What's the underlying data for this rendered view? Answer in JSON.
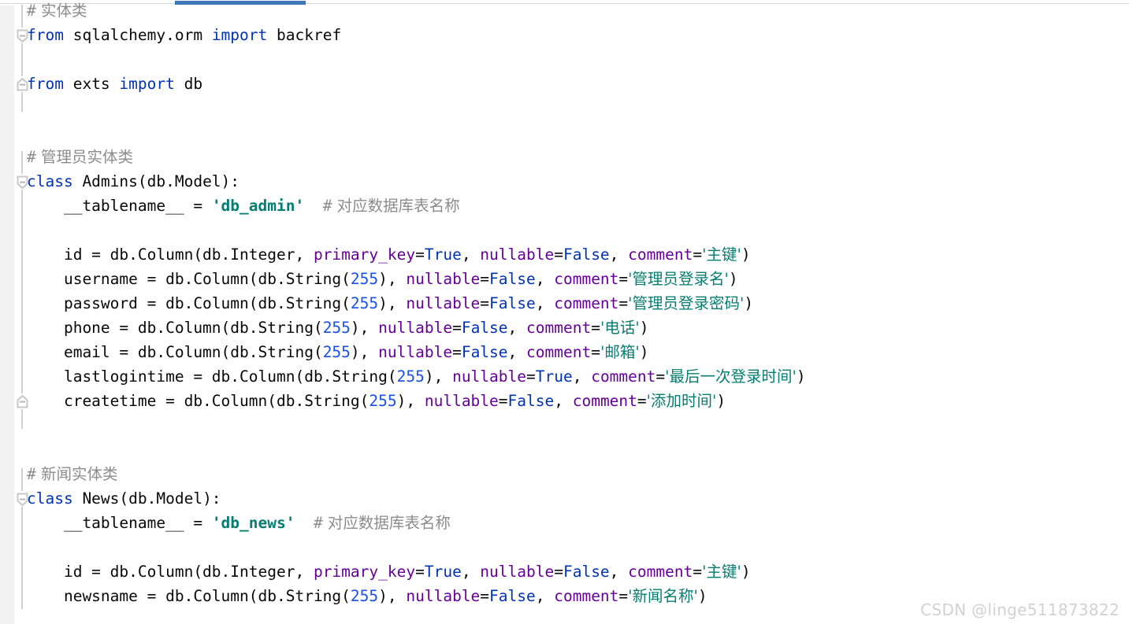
{
  "window": {
    "app": "code-editor",
    "accent_color": "#3c78b8",
    "background_color": "#ffffff",
    "gutter_color": "#f2f2f2"
  },
  "tab_strip": {
    "active_tab_underline_color": "#3c78b8"
  },
  "gutter": {
    "fold_markers": [
      {
        "type": "fold-collapse-start",
        "line": 2
      },
      {
        "type": "fold-collapse-end",
        "line": 4
      },
      {
        "type": "fold-collapse-start",
        "line": 8
      },
      {
        "type": "fold-collapse-end",
        "line": 17
      },
      {
        "type": "fold-collapse-start",
        "line": 21
      }
    ]
  },
  "editor": {
    "language": "python",
    "syntax_colors": {
      "keyword": "#0033b3",
      "comment": "#8c8c8c",
      "string": "#067d72",
      "number": "#1750eb",
      "keyword_argument": "#660099",
      "constant": "#0033b3",
      "default_text": "#080808"
    },
    "lines": [
      {
        "n": 1,
        "tokens": [
          {
            "t": "comment",
            "v": "#"
          },
          {
            "t": "comment-cjk",
            "v": " 实体类"
          }
        ]
      },
      {
        "n": 2,
        "tokens": [
          {
            "t": "kw",
            "v": "from"
          },
          {
            "t": "plain",
            "v": " sqlalchemy.orm "
          },
          {
            "t": "kw",
            "v": "import"
          },
          {
            "t": "plain",
            "v": " backref"
          }
        ]
      },
      {
        "n": 3,
        "tokens": []
      },
      {
        "n": 4,
        "tokens": [
          {
            "t": "kw",
            "v": "from"
          },
          {
            "t": "plain",
            "v": " exts "
          },
          {
            "t": "kw",
            "v": "import"
          },
          {
            "t": "plain",
            "v": " db"
          }
        ]
      },
      {
        "n": 5,
        "tokens": []
      },
      {
        "n": 6,
        "tokens": []
      },
      {
        "n": 7,
        "tokens": [
          {
            "t": "comment",
            "v": "#"
          },
          {
            "t": "comment-cjk",
            "v": " 管理员实体类"
          }
        ]
      },
      {
        "n": 8,
        "tokens": [
          {
            "t": "kw",
            "v": "class"
          },
          {
            "t": "plain",
            "v": " Admins(db.Model):"
          }
        ]
      },
      {
        "n": 9,
        "tokens": [
          {
            "t": "plain",
            "v": "    __tablename__ = "
          },
          {
            "t": "str-b",
            "v": "'db_admin'"
          },
          {
            "t": "plain",
            "v": "  "
          },
          {
            "t": "comment",
            "v": "#"
          },
          {
            "t": "comment-cjk",
            "v": " 对应数据库表名称"
          }
        ]
      },
      {
        "n": 10,
        "tokens": []
      },
      {
        "n": 11,
        "tokens": [
          {
            "t": "plain",
            "v": "    id = db.Column(db.Integer, "
          },
          {
            "t": "kwarg",
            "v": "primary_key"
          },
          {
            "t": "plain",
            "v": "="
          },
          {
            "t": "const",
            "v": "True"
          },
          {
            "t": "plain",
            "v": ", "
          },
          {
            "t": "kwarg",
            "v": "nullable"
          },
          {
            "t": "plain",
            "v": "="
          },
          {
            "t": "const",
            "v": "False"
          },
          {
            "t": "plain",
            "v": ", "
          },
          {
            "t": "kwarg",
            "v": "comment"
          },
          {
            "t": "plain",
            "v": "="
          },
          {
            "t": "str-cjk",
            "v": "'主键'"
          },
          {
            "t": "plain",
            "v": ")"
          }
        ]
      },
      {
        "n": 12,
        "tokens": [
          {
            "t": "plain",
            "v": "    username = db.Column(db.String("
          },
          {
            "t": "num",
            "v": "255"
          },
          {
            "t": "plain",
            "v": "), "
          },
          {
            "t": "kwarg",
            "v": "nullable"
          },
          {
            "t": "plain",
            "v": "="
          },
          {
            "t": "const",
            "v": "False"
          },
          {
            "t": "plain",
            "v": ", "
          },
          {
            "t": "kwarg",
            "v": "comment"
          },
          {
            "t": "plain",
            "v": "="
          },
          {
            "t": "str-cjk",
            "v": "'管理员登录名'"
          },
          {
            "t": "plain",
            "v": ")"
          }
        ]
      },
      {
        "n": 13,
        "tokens": [
          {
            "t": "plain",
            "v": "    password = db.Column(db.String("
          },
          {
            "t": "num",
            "v": "255"
          },
          {
            "t": "plain",
            "v": "), "
          },
          {
            "t": "kwarg",
            "v": "nullable"
          },
          {
            "t": "plain",
            "v": "="
          },
          {
            "t": "const",
            "v": "False"
          },
          {
            "t": "plain",
            "v": ", "
          },
          {
            "t": "kwarg",
            "v": "comment"
          },
          {
            "t": "plain",
            "v": "="
          },
          {
            "t": "str-cjk",
            "v": "'管理员登录密码'"
          },
          {
            "t": "plain",
            "v": ")"
          }
        ]
      },
      {
        "n": 14,
        "tokens": [
          {
            "t": "plain",
            "v": "    phone = db.Column(db.String("
          },
          {
            "t": "num",
            "v": "255"
          },
          {
            "t": "plain",
            "v": "), "
          },
          {
            "t": "kwarg",
            "v": "nullable"
          },
          {
            "t": "plain",
            "v": "="
          },
          {
            "t": "const",
            "v": "False"
          },
          {
            "t": "plain",
            "v": ", "
          },
          {
            "t": "kwarg",
            "v": "comment"
          },
          {
            "t": "plain",
            "v": "="
          },
          {
            "t": "str-cjk",
            "v": "'电话'"
          },
          {
            "t": "plain",
            "v": ")"
          }
        ]
      },
      {
        "n": 15,
        "tokens": [
          {
            "t": "plain",
            "v": "    email = db.Column(db.String("
          },
          {
            "t": "num",
            "v": "255"
          },
          {
            "t": "plain",
            "v": "), "
          },
          {
            "t": "kwarg",
            "v": "nullable"
          },
          {
            "t": "plain",
            "v": "="
          },
          {
            "t": "const",
            "v": "False"
          },
          {
            "t": "plain",
            "v": ", "
          },
          {
            "t": "kwarg",
            "v": "comment"
          },
          {
            "t": "plain",
            "v": "="
          },
          {
            "t": "str-cjk",
            "v": "'邮箱'"
          },
          {
            "t": "plain",
            "v": ")"
          }
        ]
      },
      {
        "n": 16,
        "tokens": [
          {
            "t": "plain",
            "v": "    lastlogintime = db.Column(db.String("
          },
          {
            "t": "num",
            "v": "255"
          },
          {
            "t": "plain",
            "v": "), "
          },
          {
            "t": "kwarg",
            "v": "nullable"
          },
          {
            "t": "plain",
            "v": "="
          },
          {
            "t": "const",
            "v": "True"
          },
          {
            "t": "plain",
            "v": ", "
          },
          {
            "t": "kwarg",
            "v": "comment"
          },
          {
            "t": "plain",
            "v": "="
          },
          {
            "t": "str-cjk",
            "v": "'最后一次登录时间'"
          },
          {
            "t": "plain",
            "v": ")"
          }
        ]
      },
      {
        "n": 17,
        "tokens": [
          {
            "t": "plain",
            "v": "    createtime = db.Column(db.String("
          },
          {
            "t": "num",
            "v": "255"
          },
          {
            "t": "plain",
            "v": "), "
          },
          {
            "t": "kwarg",
            "v": "nullable"
          },
          {
            "t": "plain",
            "v": "="
          },
          {
            "t": "const",
            "v": "False"
          },
          {
            "t": "plain",
            "v": ", "
          },
          {
            "t": "kwarg",
            "v": "comment"
          },
          {
            "t": "plain",
            "v": "="
          },
          {
            "t": "str-cjk",
            "v": "'添加时间'"
          },
          {
            "t": "plain",
            "v": ")"
          }
        ]
      },
      {
        "n": 18,
        "tokens": []
      },
      {
        "n": 19,
        "tokens": []
      },
      {
        "n": 20,
        "tokens": [
          {
            "t": "comment",
            "v": "#"
          },
          {
            "t": "comment-cjk",
            "v": " 新闻实体类"
          }
        ]
      },
      {
        "n": 21,
        "tokens": [
          {
            "t": "kw",
            "v": "class"
          },
          {
            "t": "plain",
            "v": " News(db.Model):"
          }
        ]
      },
      {
        "n": 22,
        "tokens": [
          {
            "t": "plain",
            "v": "    __tablename__ = "
          },
          {
            "t": "str-b",
            "v": "'db_news'"
          },
          {
            "t": "plain",
            "v": "  "
          },
          {
            "t": "comment",
            "v": "#"
          },
          {
            "t": "comment-cjk",
            "v": " 对应数据库表名称"
          }
        ]
      },
      {
        "n": 23,
        "tokens": []
      },
      {
        "n": 24,
        "tokens": [
          {
            "t": "plain",
            "v": "    id = db.Column(db.Integer, "
          },
          {
            "t": "kwarg",
            "v": "primary_key"
          },
          {
            "t": "plain",
            "v": "="
          },
          {
            "t": "const",
            "v": "True"
          },
          {
            "t": "plain",
            "v": ", "
          },
          {
            "t": "kwarg",
            "v": "nullable"
          },
          {
            "t": "plain",
            "v": "="
          },
          {
            "t": "const",
            "v": "False"
          },
          {
            "t": "plain",
            "v": ", "
          },
          {
            "t": "kwarg",
            "v": "comment"
          },
          {
            "t": "plain",
            "v": "="
          },
          {
            "t": "str-cjk",
            "v": "'主键'"
          },
          {
            "t": "plain",
            "v": ")"
          }
        ]
      },
      {
        "n": 25,
        "tokens": [
          {
            "t": "plain",
            "v": "    newsname = db.Column(db.String("
          },
          {
            "t": "num",
            "v": "255"
          },
          {
            "t": "plain",
            "v": "), "
          },
          {
            "t": "kwarg",
            "v": "nullable"
          },
          {
            "t": "plain",
            "v": "="
          },
          {
            "t": "const",
            "v": "False"
          },
          {
            "t": "plain",
            "v": ", "
          },
          {
            "t": "kwarg",
            "v": "comment"
          },
          {
            "t": "plain",
            "v": "="
          },
          {
            "t": "str-cjk",
            "v": "'新闻名称'"
          },
          {
            "t": "plain",
            "v": ")"
          }
        ]
      }
    ]
  },
  "watermark": {
    "text": "CSDN @linge511873822"
  }
}
